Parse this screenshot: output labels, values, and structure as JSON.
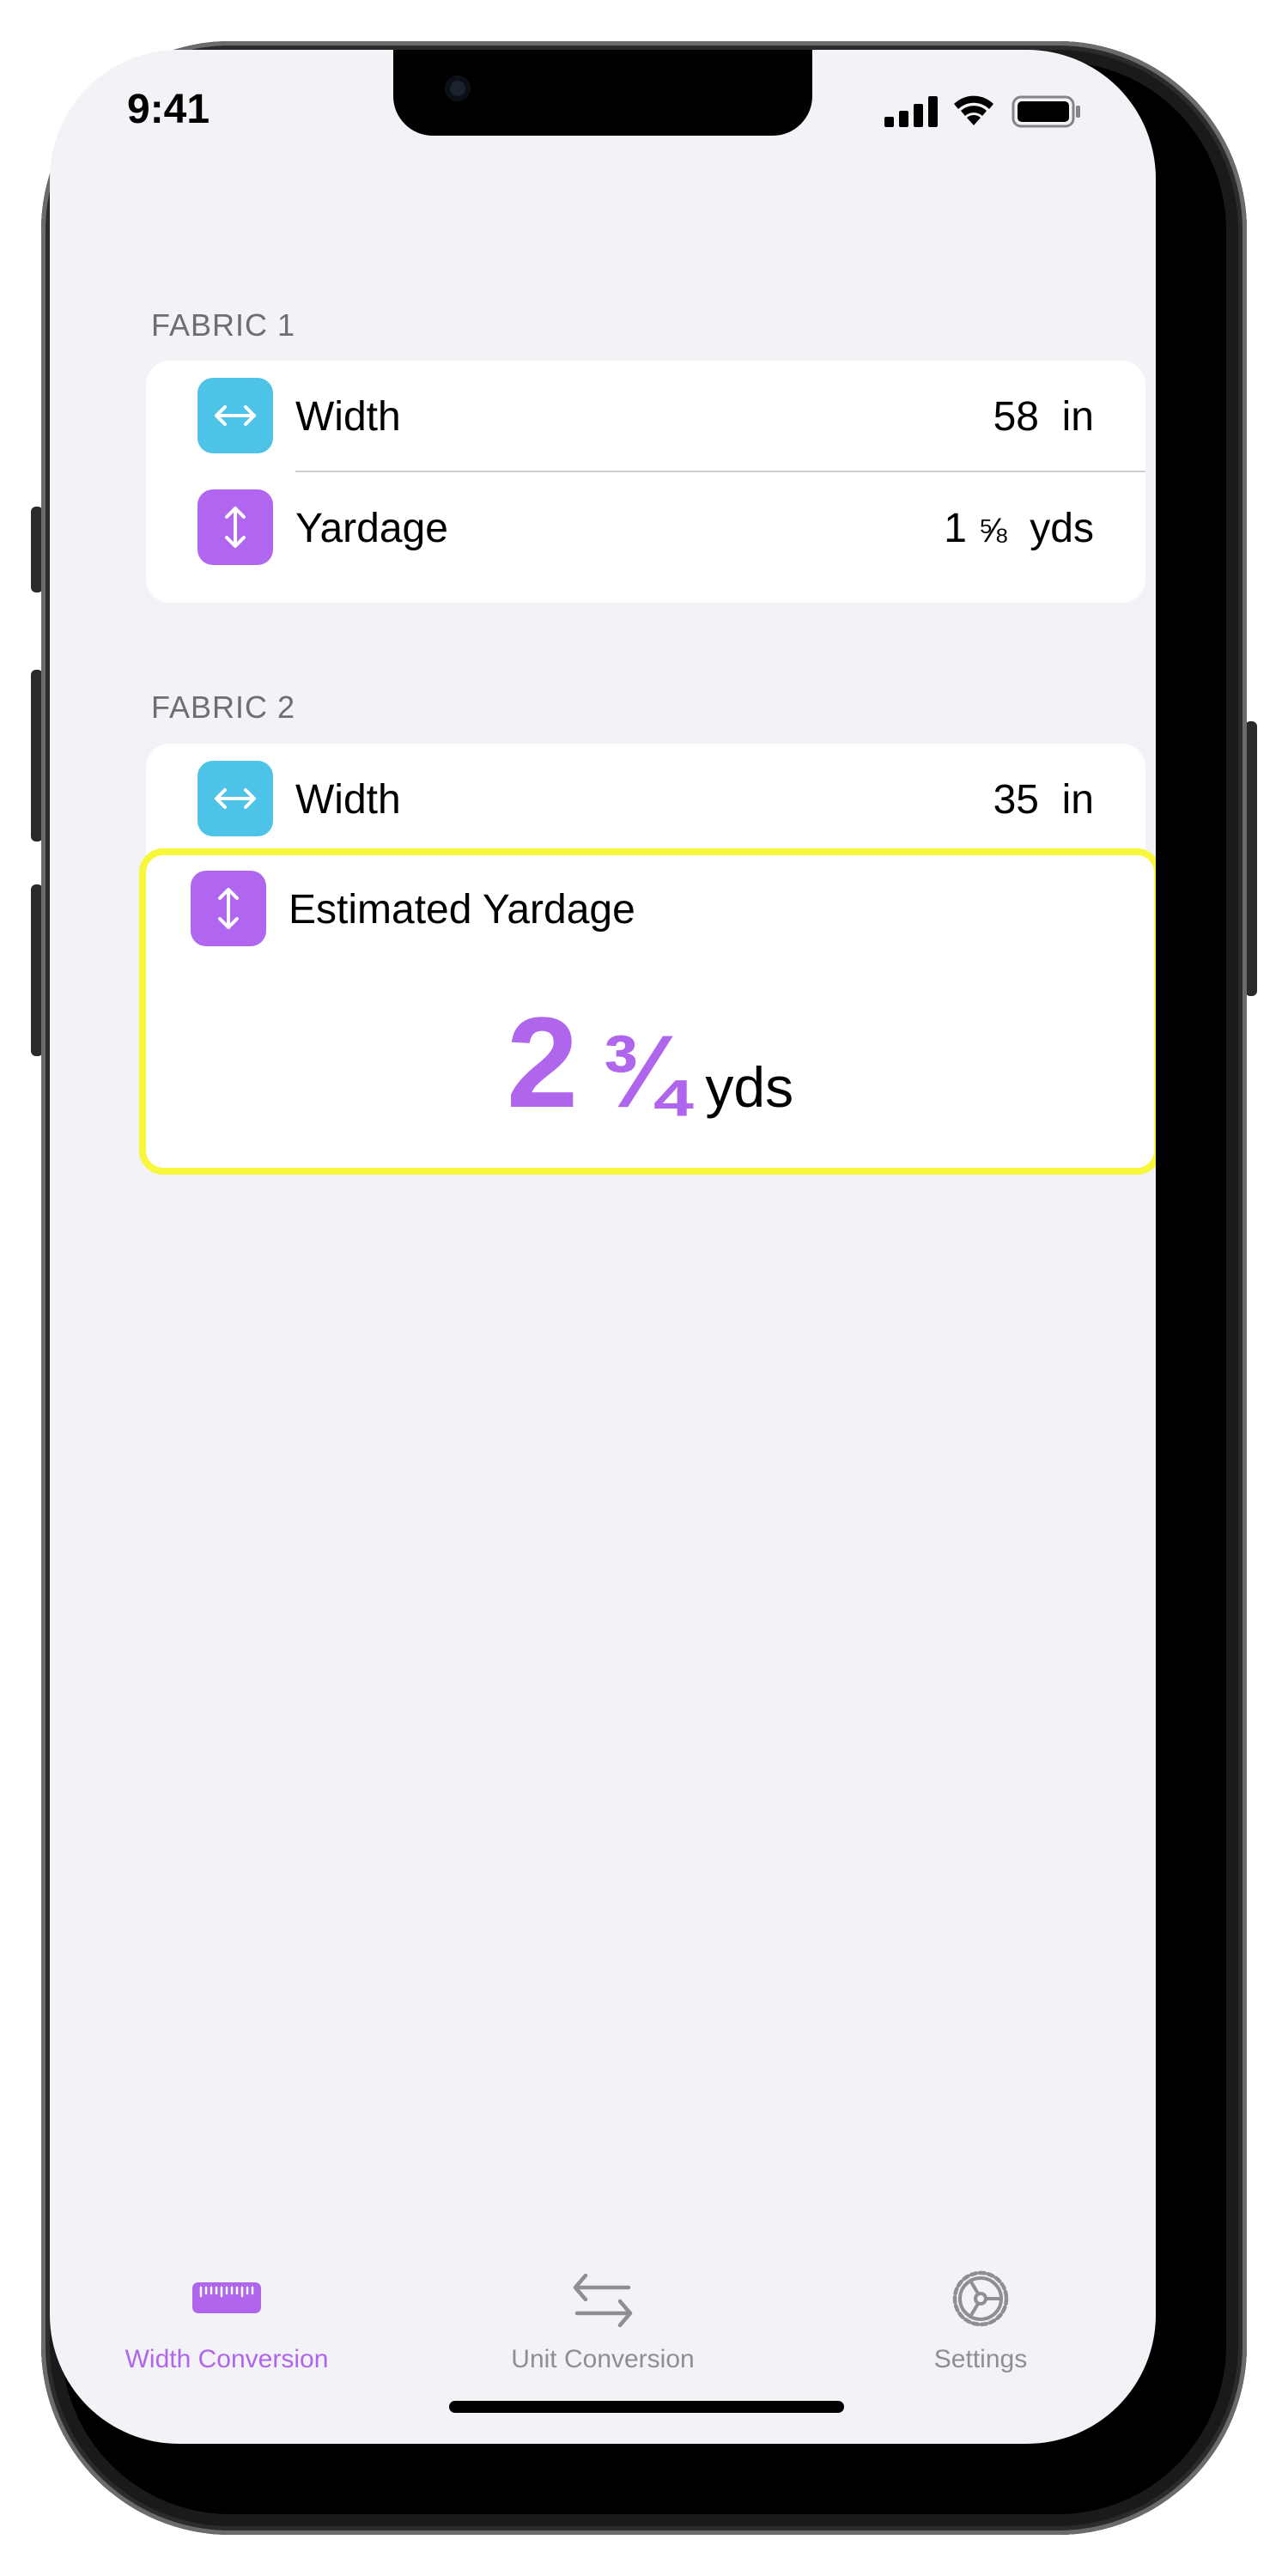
{
  "status_bar": {
    "time": "9:41"
  },
  "fabric1": {
    "header": "FABRIC 1",
    "width": {
      "label": "Width",
      "value": "58",
      "unit": "in",
      "icon": "horizontal-arrows-icon"
    },
    "yardage": {
      "label": "Yardage",
      "whole": "1",
      "fraction": "⅝",
      "unit": "yds",
      "icon": "vertical-arrows-icon"
    }
  },
  "fabric2": {
    "header": "FABRIC 2",
    "width": {
      "label": "Width",
      "value": "35",
      "unit": "in",
      "icon": "horizontal-arrows-icon"
    },
    "estimated": {
      "label": "Estimated Yardage",
      "whole": "2",
      "fraction": "¾",
      "unit": "yds",
      "icon": "vertical-arrows-icon"
    }
  },
  "tabbar": {
    "tabs": [
      {
        "label": "Width Conversion",
        "icon": "ruler-icon",
        "active": true
      },
      {
        "label": "Unit Conversion",
        "icon": "swap-arrows-icon",
        "active": false
      },
      {
        "label": "Settings",
        "icon": "gear-icon",
        "active": false
      }
    ]
  },
  "colors": {
    "accent": "#b065ed",
    "blue_icon": "#4dc3e8",
    "purple_icon": "#b166f0",
    "highlight": "#f7f73c",
    "background": "#f2f2f7"
  }
}
